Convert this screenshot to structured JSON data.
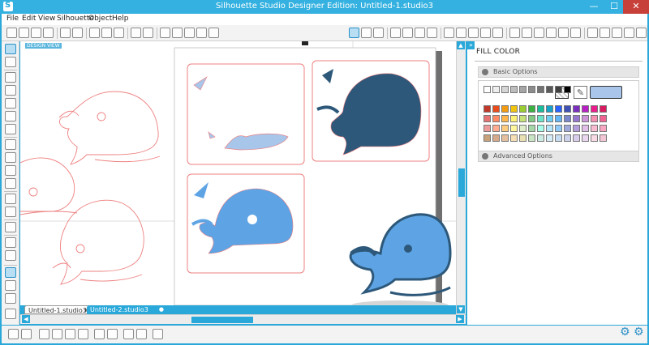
{
  "window": {
    "title": "Silhouette Studio Designer Edition: Untitled-1.studio3",
    "minimize": "—",
    "maximize": "☐",
    "close": "✕"
  },
  "menu": [
    "File",
    "Edit",
    "View",
    "Silhouette",
    "Object",
    "Help"
  ],
  "canvas": {
    "design_view_label": "DESIGN VIEW"
  },
  "tabs": [
    {
      "label": "Untitled-1.studio3",
      "close": "x"
    },
    {
      "label": "Untitled-2.studio3",
      "close": "●"
    }
  ],
  "panel": {
    "title": "FILL COLOR",
    "basic_options": "Basic Options",
    "advanced_options": "Advanced Options",
    "current_color": "#a9c6ea"
  },
  "colors": {
    "accent": "#29a8d9",
    "whale_dark": "#2d587a",
    "whale_mid": "#5ea4e4",
    "whale_light": "#a8c5ea",
    "outline": "#ee8080"
  },
  "palette_rows": [
    [
      "#ffffff",
      "#eeeeee",
      "#d6d6d6",
      "#bdbdbd",
      "#a5a5a5",
      "#8c8c8c",
      "#737373",
      "#5a5a5a",
      "#404040",
      "#000000"
    ],
    [
      "#c0392b",
      "#e84c1d",
      "#f39c12",
      "#f1c40f",
      "#9acd32",
      "#3cb043",
      "#1abc9c",
      "#17a2c7",
      "#2962ff",
      "#3f51b5",
      "#7b2fbf",
      "#b620c4",
      "#e91e8c",
      "#d81b60"
    ],
    [
      "#e57373",
      "#ff8a65",
      "#ffb74d",
      "#fff176",
      "#c5e17a",
      "#81c784",
      "#6be3c8",
      "#6ecff2",
      "#64b5f6",
      "#7986cb",
      "#9575cd",
      "#ce93d8",
      "#f48fb1",
      "#f06292"
    ],
    [
      "#ef9a9a",
      "#ffab91",
      "#ffcc80",
      "#fff59d",
      "#dcedc8",
      "#a5d6a7",
      "#a7ffeb",
      "#b3e5fc",
      "#90caf9",
      "#9fa8da",
      "#b39ddb",
      "#e1bee7",
      "#f8bbd0",
      "#f8a5c2"
    ],
    [
      "#c8a27a",
      "#d7a98c",
      "#e6c09e",
      "#f5deb3",
      "#e8e0b0",
      "#c9e4c5",
      "#cdebe5",
      "#d4ecf7",
      "#c6dcf2",
      "#ccd2ec",
      "#d8cdeb",
      "#ead6ee",
      "#f8d9e4",
      "#f3c6d6"
    ]
  ]
}
